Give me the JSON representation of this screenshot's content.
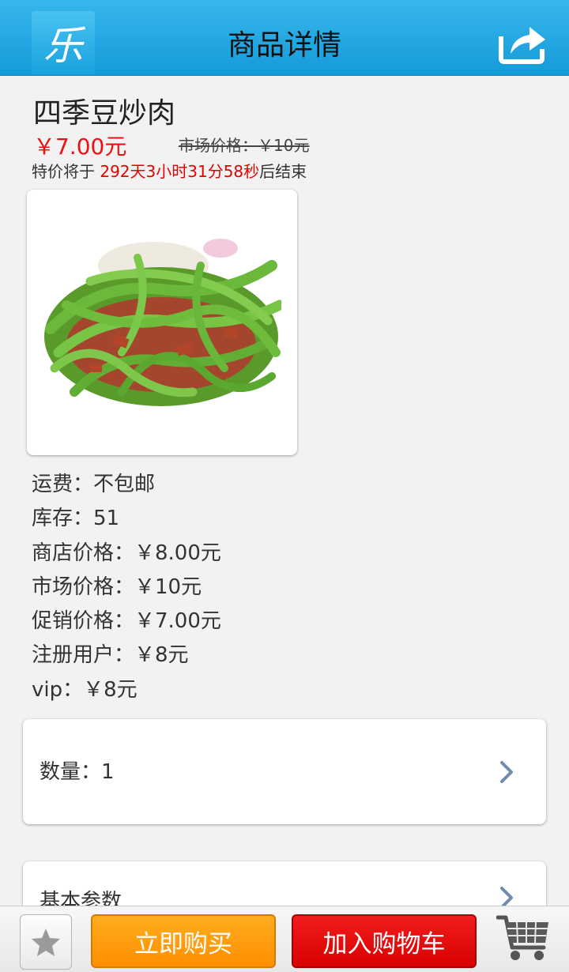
{
  "header": {
    "logo_char": "乐",
    "title": "商品详情"
  },
  "product": {
    "name": "四季豆炒肉",
    "price_now": "￥7.00元",
    "market_price_strike": "市场价格：￥10元",
    "countdown_prefix": "特价将于 ",
    "countdown_time": "292天3小时31分58秒",
    "countdown_suffix": "后结束"
  },
  "details": {
    "shipping": "运费：不包邮",
    "stock": "库存：51",
    "shop_price": "商店价格：￥8.00元",
    "market_price": "市场价格：￥10元",
    "promo_price": "促销价格：￥7.00元",
    "member_price": "注册用户：￥8元",
    "vip_price": "vip：￥8元"
  },
  "quantity": {
    "label": "数量：1"
  },
  "params": {
    "label": "基本参数"
  },
  "bottom": {
    "buy_now": "立即购买",
    "add_to_cart": "加入购物车"
  },
  "colors": {
    "header": "#1aa6e2",
    "price_red": "#ee1111",
    "buy_orange": "#ff9a0d",
    "cart_red": "#e60c0c"
  },
  "icons": [
    "logo-icon",
    "share-icon",
    "chevron-right-icon",
    "star-icon",
    "shopping-cart-icon"
  ]
}
